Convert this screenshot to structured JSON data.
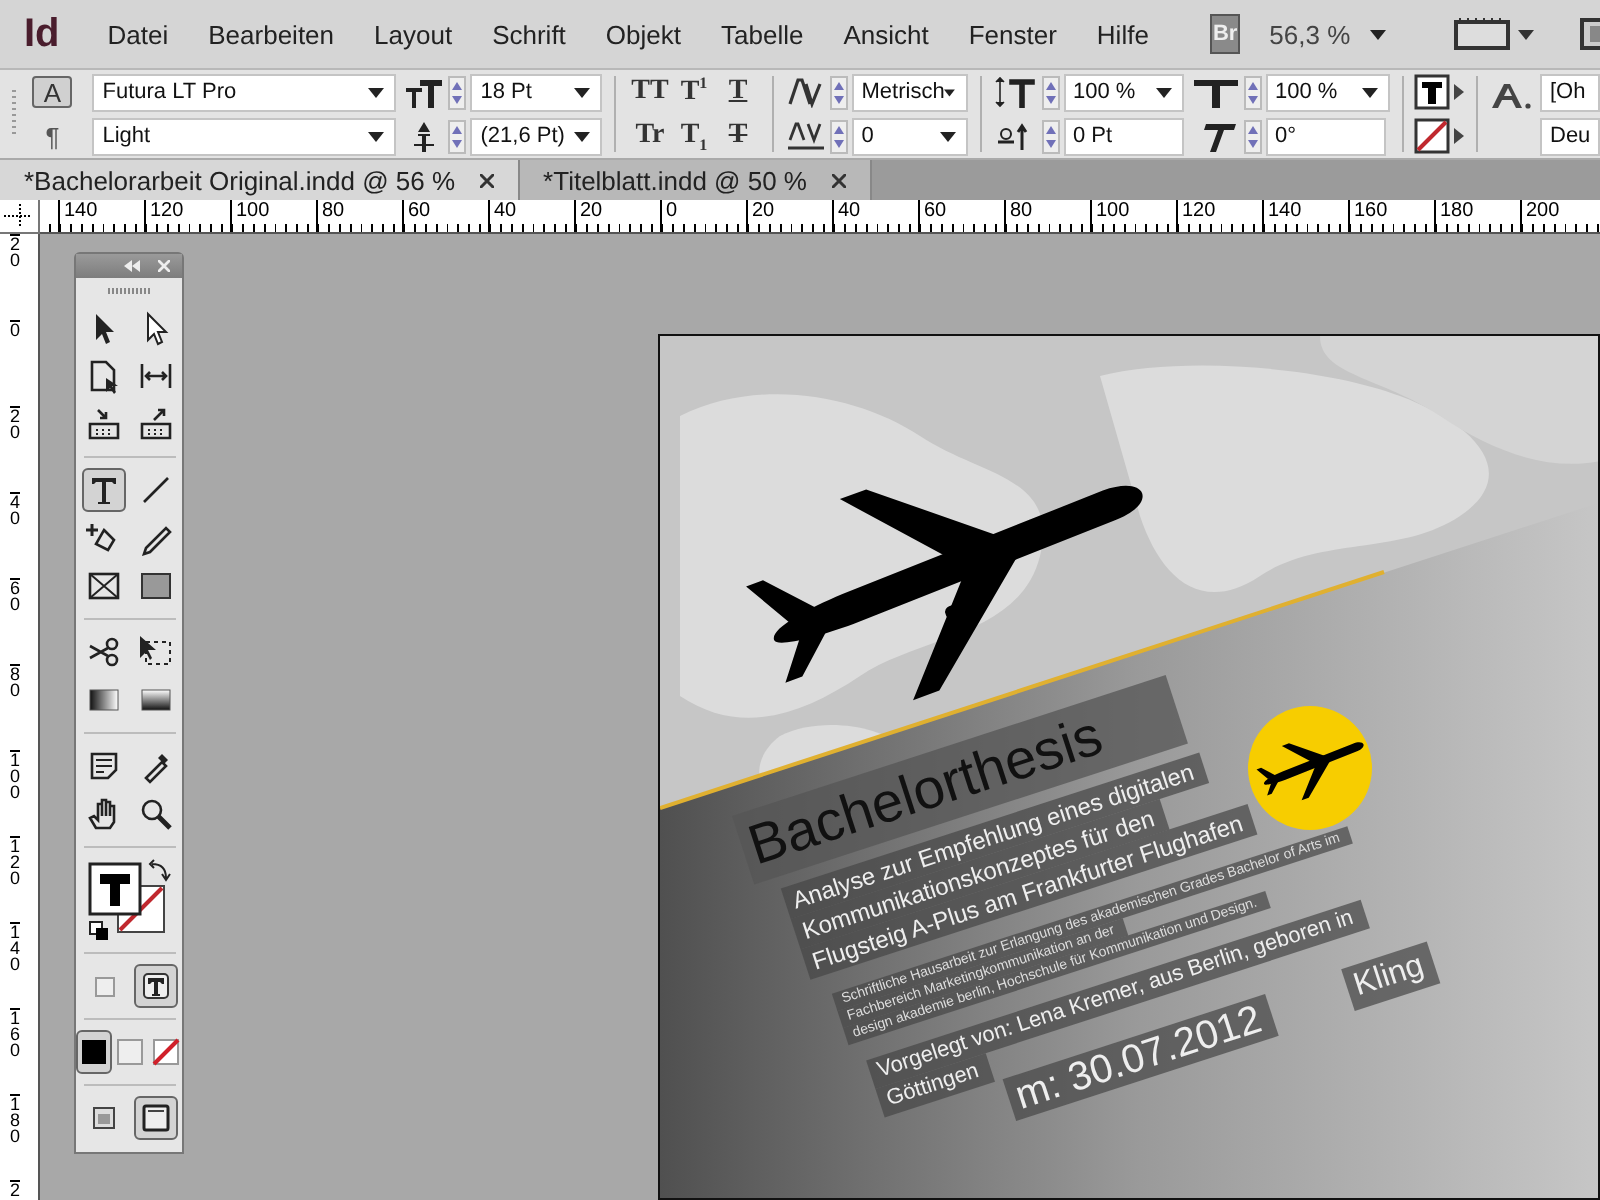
{
  "menu_bar": {
    "app_logo": "Id",
    "menus": [
      "Datei",
      "Bearbeiten",
      "Layout",
      "Schrift",
      "Objekt",
      "Tabelle",
      "Ansicht",
      "Fenster",
      "Hilfe"
    ],
    "bridge_button": "Br",
    "zoom": "56,3 %"
  },
  "control_panel": {
    "modes": [
      {
        "label": "A",
        "selected": true
      },
      {
        "label": "¶",
        "selected": false
      }
    ],
    "font_family": "Futura LT Pro",
    "font_style": "Light",
    "font_size": "18 Pt",
    "leading": "(21,6 Pt)",
    "type_styles": [
      {
        "kind": "all-caps",
        "label": "TT"
      },
      {
        "kind": "superscript",
        "label": "T$^{1}$"
      },
      {
        "kind": "underline",
        "label": "T"
      },
      {
        "kind": "small-caps",
        "label": "Tr"
      },
      {
        "kind": "subscript",
        "label": "T$_{1}$"
      },
      {
        "kind": "strikethrough",
        "label": "T"
      }
    ],
    "kerning": "Metrisch",
    "tracking": "0",
    "vertical_scale": "100 %",
    "baseline_shift": "0 Pt",
    "horizontal_scale": "100 %",
    "skew": "0°",
    "character_style": "[Oh",
    "language": "Deu"
  },
  "tabs": [
    {
      "label": "*Bachelorarbeit Original.indd @ 56 %",
      "selected": true
    },
    {
      "label": "*Titelblatt.indd @ 50 %",
      "selected": false
    }
  ],
  "rulers": {
    "horizontal": [
      "140",
      "120",
      "100",
      "80",
      "60",
      "40",
      "20",
      "0",
      "20",
      "40",
      "60",
      "80",
      "100",
      "120",
      "140",
      "160",
      "180",
      "200"
    ],
    "vertical": [
      "20",
      "0",
      "20",
      "40",
      "60",
      "80",
      "100",
      "120",
      "140",
      "160",
      "180",
      "2"
    ]
  },
  "tools_panel": {
    "groups": [
      {
        "tools": [
          {
            "kind": "selection",
            "selected": false
          },
          {
            "kind": "direct-selection",
            "selected": false
          },
          {
            "kind": "page",
            "selected": false
          },
          {
            "kind": "gap",
            "selected": false
          },
          {
            "kind": "content-collector",
            "selected": false
          },
          {
            "kind": "content-placer",
            "selected": false
          }
        ]
      },
      {
        "tools": [
          {
            "kind": "type",
            "selected": true
          },
          {
            "kind": "line",
            "selected": false
          },
          {
            "kind": "pen",
            "selected": false
          },
          {
            "kind": "pencil",
            "selected": false
          },
          {
            "kind": "frame",
            "selected": false
          },
          {
            "kind": "rectangle",
            "selected": false
          }
        ]
      },
      {
        "tools": [
          {
            "kind": "scissors",
            "selected": false
          },
          {
            "kind": "free-transform",
            "selected": false
          },
          {
            "kind": "gradient",
            "selected": false
          },
          {
            "kind": "feather",
            "selected": false
          }
        ]
      },
      {
        "tools": [
          {
            "kind": "note",
            "selected": false
          },
          {
            "kind": "eyedropper",
            "selected": false
          },
          {
            "kind": "hand",
            "selected": false
          },
          {
            "kind": "zoom",
            "selected": false
          }
        ]
      }
    ],
    "formatting": [
      {
        "kind": "container",
        "selected": false
      },
      {
        "kind": "text",
        "selected": true
      }
    ],
    "apply": [
      {
        "kind": "color",
        "selected": true
      },
      {
        "kind": "gradient",
        "selected": false
      },
      {
        "kind": "none",
        "selected": false
      }
    ],
    "screen_modes": [
      {
        "kind": "normal",
        "selected": false
      },
      {
        "kind": "preview",
        "selected": true
      }
    ]
  },
  "page": {
    "title": "Bachelorthesis",
    "subtitle": [
      "Analyse zur Empfehlung eines digitalen",
      "Kommunikationskonzeptes für den",
      "Flugsteig A-Plus am Frankfurter Flughafen"
    ],
    "note": [
      "Schriftliche Hausarbeit zur Erlangung des akademischen Grades Bachelor of Arts im",
      "Fachbereich Marketingkommunikation an der",
      "design akademie berlin, Hochschule für Kommunikation und Design."
    ],
    "author": [
      "Vorgelegt von: Lena Kremer, aus Berlin, geboren in",
      "Göttingen"
    ],
    "date": "m: 30.07.2012",
    "tail": "Kling"
  }
}
